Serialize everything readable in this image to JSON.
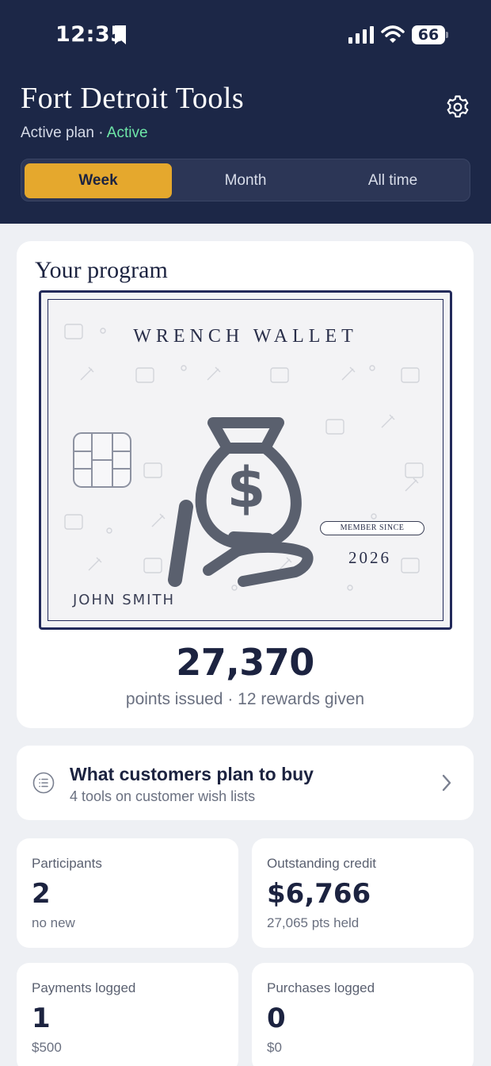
{
  "status_bar": {
    "time": "12:35",
    "battery": "66"
  },
  "header": {
    "title": "Fort Detroit Tools",
    "plan_label": "Active plan",
    "plan_separator": " · ",
    "plan_status": "Active"
  },
  "period_tabs": [
    {
      "label": "Week",
      "selected": true
    },
    {
      "label": "Month",
      "selected": false
    },
    {
      "label": "All time",
      "selected": false
    }
  ],
  "program": {
    "title": "Your program",
    "card": {
      "brand": "WRENCH WALLET",
      "member_since_label": "MEMBER SINCE",
      "member_year": "2026",
      "holder": "JOHN SMITH"
    },
    "points_value": "27,370",
    "points_caption": "points issued · 12 rewards given"
  },
  "wishlist": {
    "title": "What customers plan to buy",
    "subtitle": "4 tools on customer wish lists"
  },
  "stats": [
    {
      "label": "Participants",
      "value": "2",
      "sub": "no new"
    },
    {
      "label": "Outstanding credit",
      "value": "$6,766",
      "sub": "27,065 pts held"
    },
    {
      "label": "Payments logged",
      "value": "1",
      "sub": "$500"
    },
    {
      "label": "Purchases logged",
      "value": "0",
      "sub": "$0"
    }
  ],
  "colors": {
    "header_bg": "#1c2747",
    "accent": "#e5a82d",
    "active_status": "#6ee7a8",
    "page_bg": "#eef0f4"
  }
}
